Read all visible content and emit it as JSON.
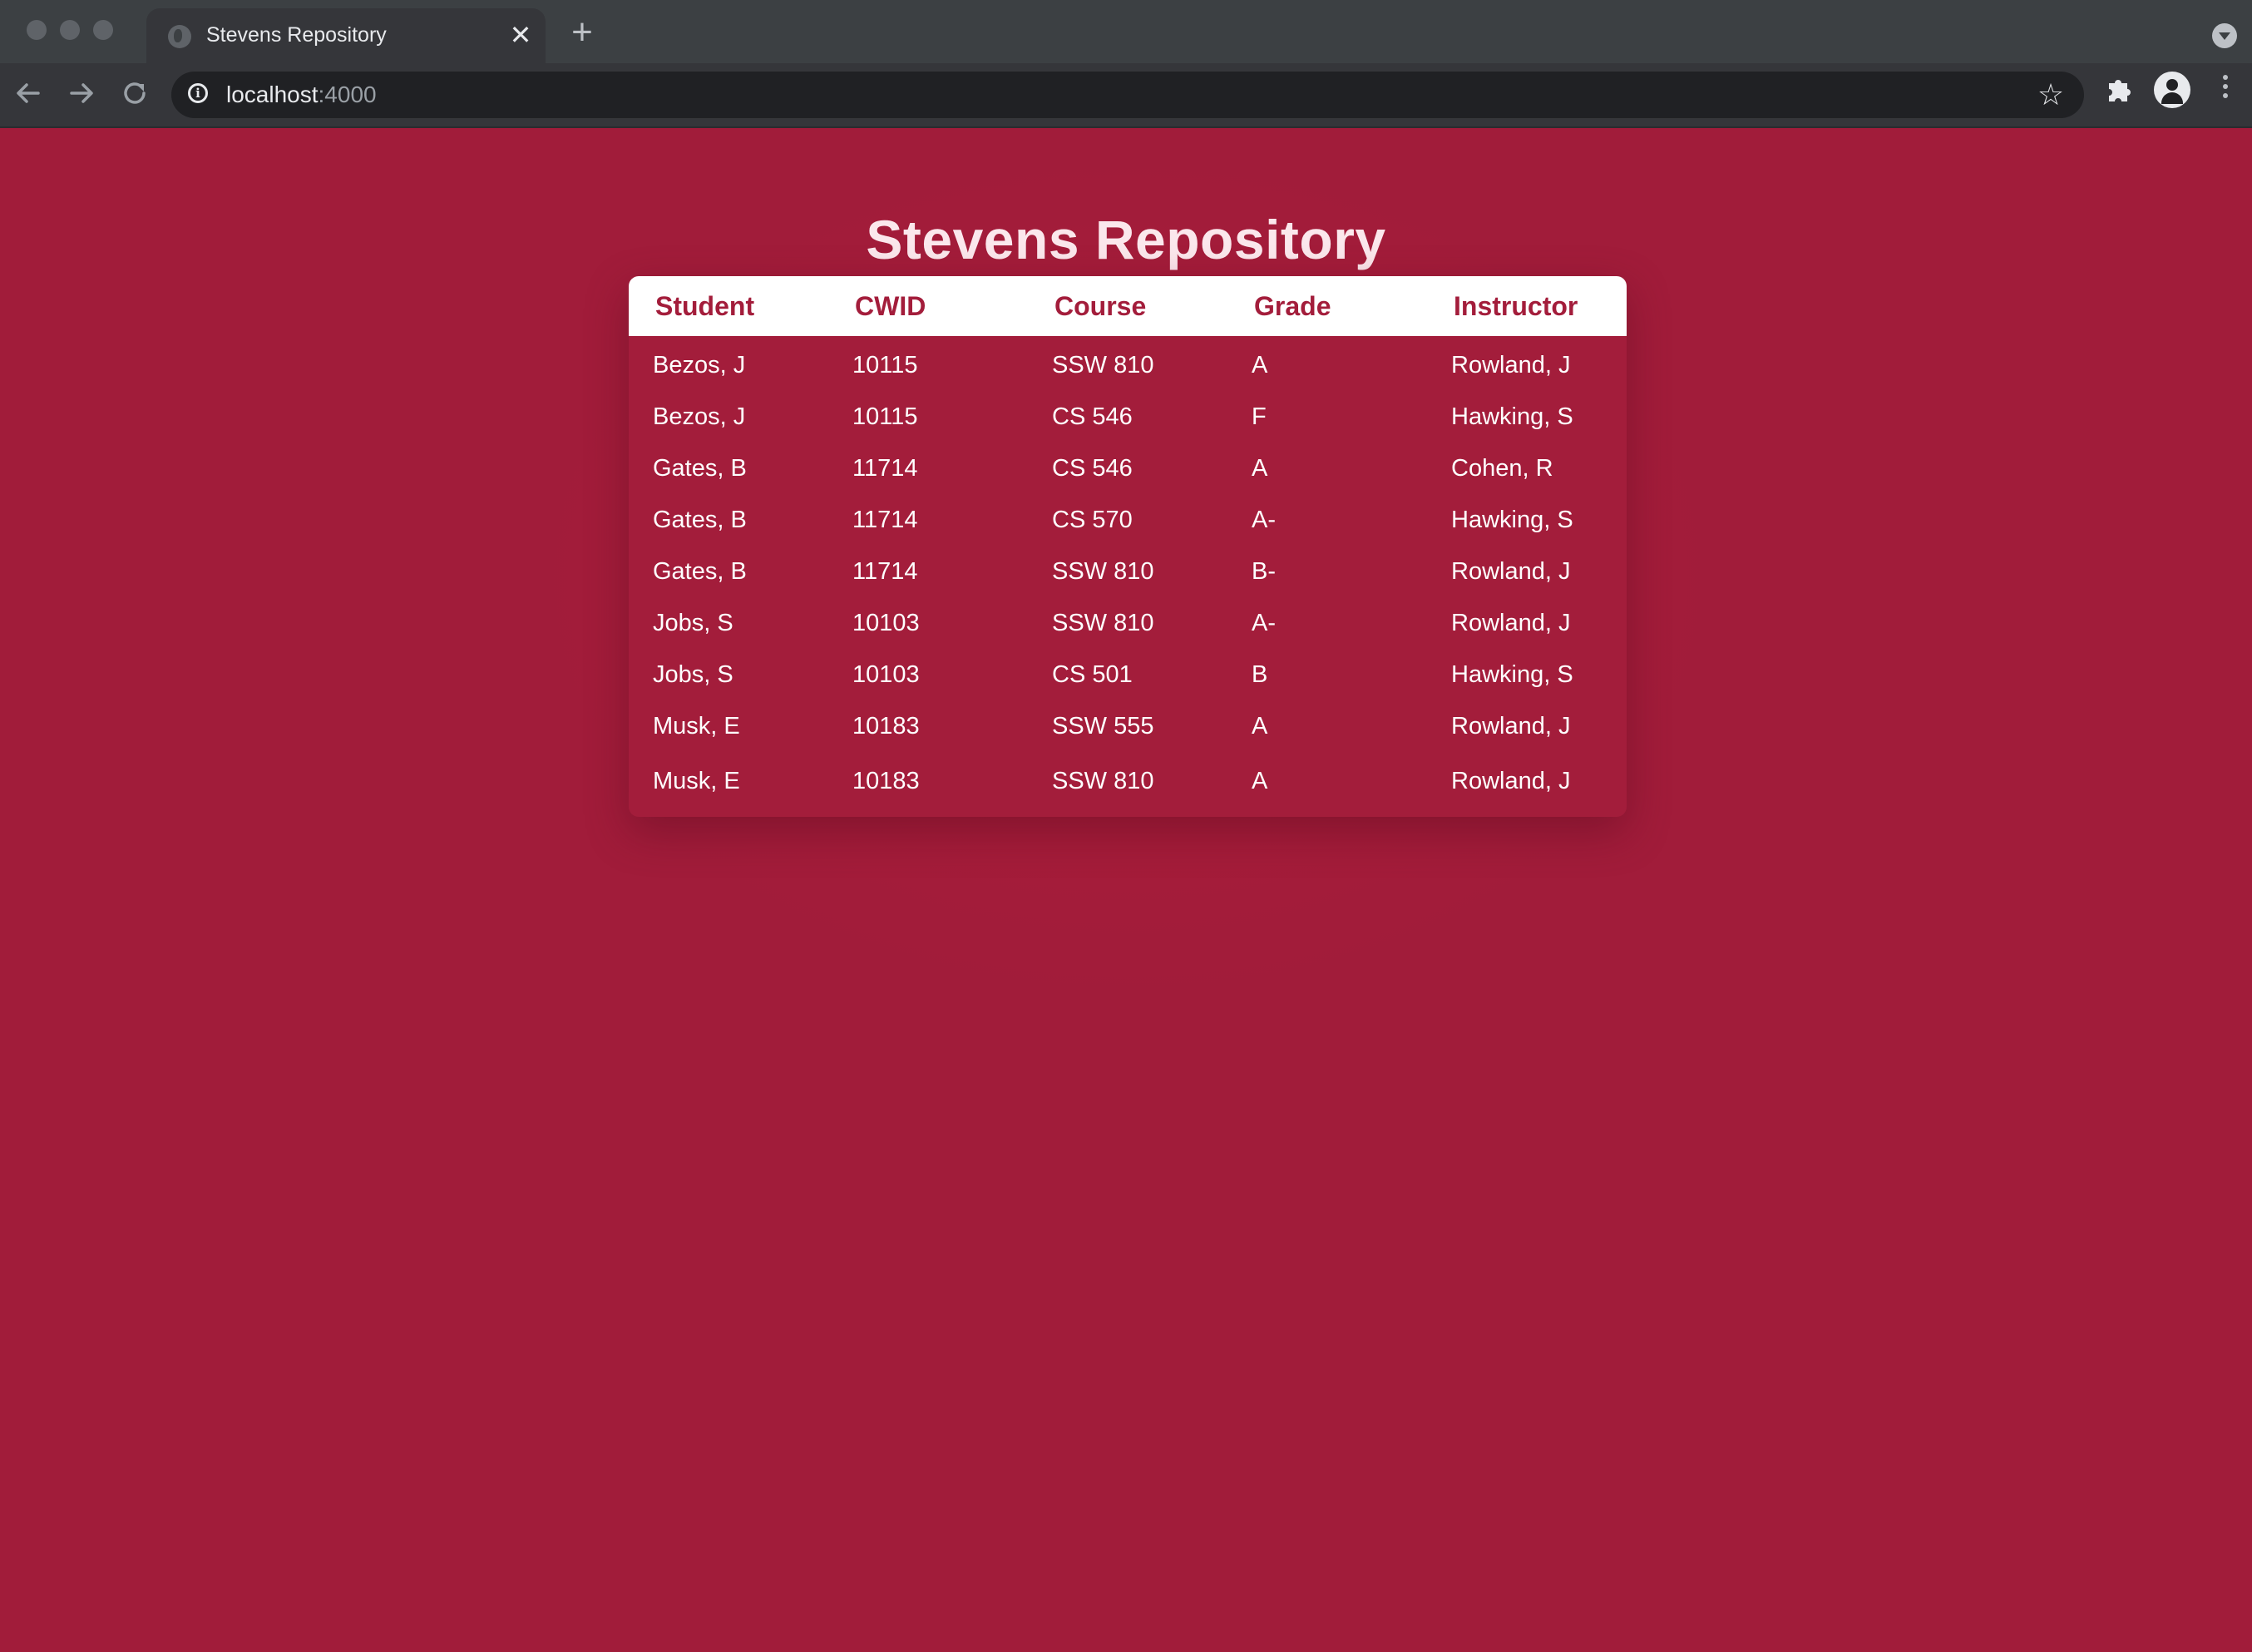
{
  "browser": {
    "tab_title": "Stevens Repository",
    "tab_close_glyph": "✕",
    "new_tab_glyph": "+",
    "url_host": "localhost",
    "url_port": ":4000"
  },
  "icons": {
    "back": "arrow-left-icon",
    "forward": "arrow-right-icon",
    "reload": "reload-icon",
    "info": "info-icon",
    "star": "star-icon",
    "extensions": "puzzle-icon",
    "profile": "profile-icon",
    "menu": "kebab-menu-icon"
  },
  "colors": {
    "page_background": "#a11c3a",
    "table_header_background": "#ffffff",
    "table_header_text": "#a31d3b",
    "row_text": "#ffffff"
  },
  "page": {
    "title": "Stevens Repository"
  },
  "table": {
    "columns": [
      "Student",
      "CWID",
      "Course",
      "Grade",
      "Instructor"
    ],
    "rows": [
      [
        "Bezos, J",
        "10115",
        "SSW 810",
        "A",
        "Rowland, J"
      ],
      [
        "Bezos, J",
        "10115",
        "CS 546",
        "F",
        "Hawking, S"
      ],
      [
        "Gates, B",
        "11714",
        "CS 546",
        "A",
        "Cohen, R"
      ],
      [
        "Gates, B",
        "11714",
        "CS 570",
        "A-",
        "Hawking, S"
      ],
      [
        "Gates, B",
        "11714",
        "SSW 810",
        "B-",
        "Rowland, J"
      ],
      [
        "Jobs, S",
        "10103",
        "SSW 810",
        "A-",
        "Rowland, J"
      ],
      [
        "Jobs, S",
        "10103",
        "CS 501",
        "B",
        "Hawking, S"
      ],
      [
        "Musk, E",
        "10183",
        "SSW 555",
        "A",
        "Rowland, J"
      ],
      [
        "Musk, E",
        "10183",
        "SSW 810",
        "A",
        "Rowland, J"
      ]
    ]
  }
}
